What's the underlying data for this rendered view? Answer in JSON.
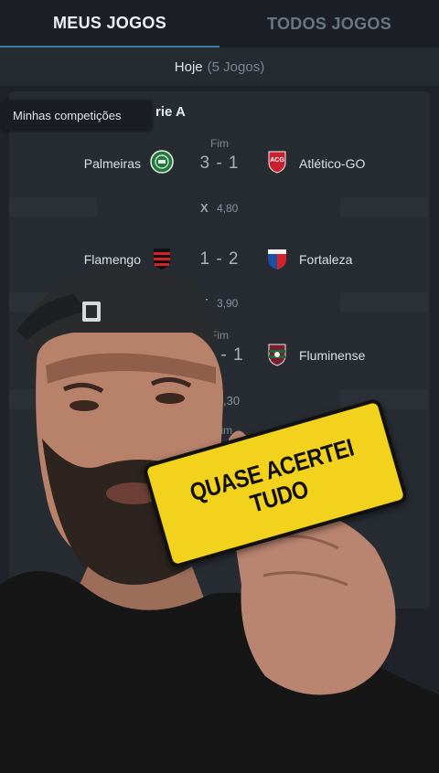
{
  "tabs": [
    {
      "label": "MEUS JOGOS",
      "active": true
    },
    {
      "label": "TODOS JOGOS",
      "active": false
    }
  ],
  "day": {
    "label": "Hoje",
    "count": "(5 Jogos)"
  },
  "competition": {
    "title": "rie A",
    "tooltip": "Minhas competições"
  },
  "matches": [
    {
      "status": "Fim",
      "home": "Palmeiras",
      "home_icon": "palmeiras-crest-icon",
      "score": "3 - 1",
      "away": "Atlético-GO",
      "away_icon": "atletico-go-crest-icon",
      "odd_x": "X",
      "odd_value": "4,80"
    },
    {
      "status": "",
      "home": "Flamengo",
      "home_icon": "flamengo-crest-icon",
      "score": "1 - 2",
      "away": "Fortaleza",
      "away_icon": "fortaleza-crest-icon",
      "odd_x": "X",
      "odd_value": "3,90"
    },
    {
      "status": "Fim",
      "home": "",
      "home_icon": "",
      "score": "- 1",
      "away": "Fluminense",
      "away_icon": "fluminense-crest-icon",
      "odd_x": "",
      "odd_value": ",30"
    },
    {
      "status": "Fim"
    }
  ],
  "sticker": {
    "line1": "QUASE ACERTEI",
    "line2": "TUDO"
  },
  "colors": {
    "background": "#1f2329",
    "card": "#272c33",
    "tab_underline": "#3f7fa8",
    "sticker": "#f3d21d"
  }
}
